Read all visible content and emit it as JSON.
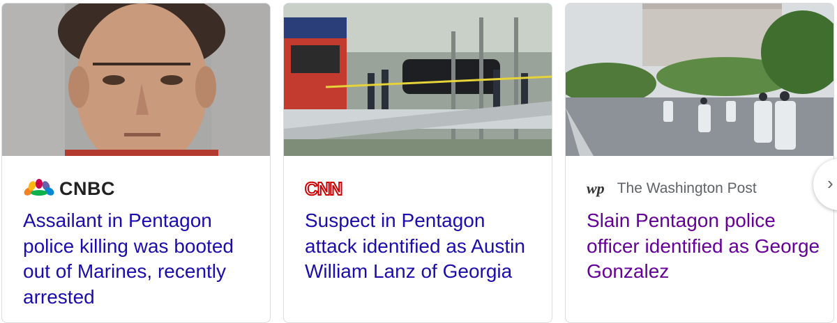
{
  "cards": [
    {
      "source": "CNBC",
      "headline": "Assailant in Pentagon police killing was booted out of Marines, recently arrested",
      "visited": false,
      "thumbnail": "mugshot-photo"
    },
    {
      "source": "CNN",
      "headline": "Suspect in Pentagon attack identified as Austin William Lanz of Georgia",
      "visited": false,
      "thumbnail": "crime-scene-photo"
    },
    {
      "source": "The Washington Post",
      "source_mark": "wp",
      "headline": "Slain Pentagon police officer identified as George Gonzalez",
      "visited": true,
      "thumbnail": "motorcycle-procession-photo"
    }
  ],
  "next_button": {
    "icon": "chevron-right-icon",
    "glyph": "›"
  },
  "colors": {
    "headline_link": "#1a0dab",
    "headline_visited": "#660099",
    "card_border": "#dadce0",
    "source_text": "#5f6368"
  }
}
